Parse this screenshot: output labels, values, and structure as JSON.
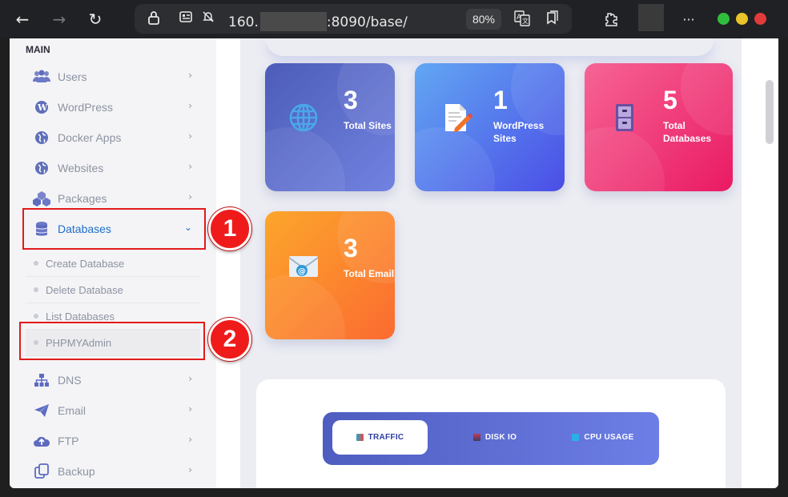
{
  "browser": {
    "url_prefix": "160.",
    "url_suffix": ":8090/base/",
    "zoom": "80%",
    "more": "···"
  },
  "sidebar": {
    "heading": "MAIN",
    "items": [
      {
        "label": "Users",
        "icon": "users-icon"
      },
      {
        "label": "WordPress",
        "icon": "wordpress-icon"
      },
      {
        "label": "Docker Apps",
        "icon": "globe-icon"
      },
      {
        "label": "Websites",
        "icon": "globe-icon"
      },
      {
        "label": "Packages",
        "icon": "packages-icon"
      },
      {
        "label": "Databases",
        "icon": "database-icon",
        "active": true
      },
      {
        "label": "DNS",
        "icon": "sitemap-icon"
      },
      {
        "label": "Email",
        "icon": "paper-plane-icon"
      },
      {
        "label": "FTP",
        "icon": "cloud-upload-icon"
      },
      {
        "label": "Backup",
        "icon": "copy-icon"
      }
    ],
    "database_submenu": [
      "Create Database",
      "Delete Database",
      "List Databases",
      "PHPMYAdmin"
    ]
  },
  "annotations": {
    "step1": "1",
    "step2": "2",
    "color": "#e21a1a"
  },
  "cards": [
    {
      "number": "3",
      "label": "Total Sites",
      "icon": "globe-icon",
      "color": "#5b6bd0"
    },
    {
      "number": "1",
      "label": "WordPress Sites",
      "icon": "edit-document-icon",
      "color": "#4f63ea"
    },
    {
      "number": "5",
      "label": "Total Databases",
      "icon": "file-cabinet-icon",
      "color": "#ec3f7f"
    },
    {
      "number": "3",
      "label": "Total Emails",
      "icon": "email-icon",
      "color": "#fb8c2a"
    }
  ],
  "chart_tabs": [
    {
      "label": "TRAFFIC",
      "active": true
    },
    {
      "label": "DISK IO",
      "active": false
    },
    {
      "label": "CPU USAGE",
      "active": false
    }
  ]
}
